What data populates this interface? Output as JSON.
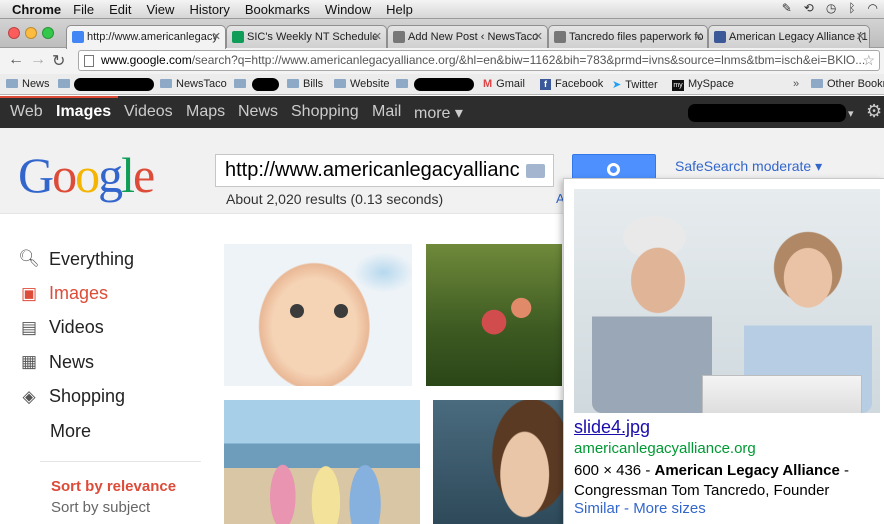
{
  "menubar": {
    "app": "Chrome",
    "items": [
      "File",
      "Edit",
      "View",
      "History",
      "Bookmarks",
      "Window",
      "Help"
    ]
  },
  "tabs": [
    {
      "label": "http://www.americanlegacy",
      "favicon_color": "#4285f4",
      "active": true
    },
    {
      "label": "SIC's Weekly NT Schedule",
      "favicon_color": "#0f9d58",
      "active": false
    },
    {
      "label": "Add New Post ‹ NewsTaco",
      "favicon_color": "#777777",
      "active": false
    },
    {
      "label": "Tancredo files paperwork fo",
      "favicon_color": "#777777",
      "active": false
    },
    {
      "label": "American Legacy Alliance (1",
      "favicon_color": "#3b5998",
      "active": false
    }
  ],
  "omnibox": {
    "host": "www.google.com",
    "path": "/search?q=http://www.americanlegacyalliance.org/&hl=en&biw=1162&bih=783&prmd=ivns&source=lnms&tbm=isch&ei=BKlO..."
  },
  "bookmarks": [
    "News",
    "NewsTaco",
    "Bills",
    "Website",
    "Gmail",
    "Facebook",
    "Twitter",
    "MySpace",
    "Other Bookm"
  ],
  "gbar": {
    "items": [
      "Web",
      "Images",
      "Videos",
      "Maps",
      "News",
      "Shopping",
      "Mail",
      "more ▾"
    ],
    "selected": "Images"
  },
  "logo": {
    "letters": [
      "G",
      "o",
      "o",
      "g",
      "l",
      "e"
    ],
    "colors": [
      "#3366cc",
      "#dd4b39",
      "#f4b400",
      "#3366cc",
      "#109d58",
      "#dd4b39"
    ]
  },
  "search": {
    "query": "http://www.americanlegacyallianc",
    "safesearch": "SafeSearch moderate ▾",
    "stats": "About 2,020 results (0.13 seconds)",
    "stats_link": "A"
  },
  "leftnav": {
    "items": [
      {
        "label": "Everything",
        "icon": "search-icon",
        "glyph": "🔍"
      },
      {
        "label": "Images",
        "icon": "camera-icon",
        "glyph": "📷"
      },
      {
        "label": "Videos",
        "icon": "film-icon",
        "glyph": "🎬"
      },
      {
        "label": "News",
        "icon": "newspaper-icon",
        "glyph": "📰"
      },
      {
        "label": "Shopping",
        "icon": "tag-icon",
        "glyph": "🏷"
      },
      {
        "label": "More",
        "icon": "",
        "glyph": ""
      }
    ],
    "selected": "Images",
    "sort_relevance": "Sort by relevance",
    "sort_subject": "Sort by subject"
  },
  "preview": {
    "filename": "slide4.jpg",
    "domain": "americanlegacyalliance.org",
    "dimensions": "600 × 436",
    "title": "American Legacy Alliance",
    "subtitle": "Congressman Tom Tancredo, Founder",
    "link_similar": "Similar",
    "link_more_sizes": "More sizes",
    "link_separator": " - "
  },
  "colors": {
    "gbar_bg": "#2d2d2d",
    "accent_red": "#dd4b39",
    "link_blue": "#3366cc",
    "url_green": "#009933",
    "search_button": "#4d90fe"
  }
}
